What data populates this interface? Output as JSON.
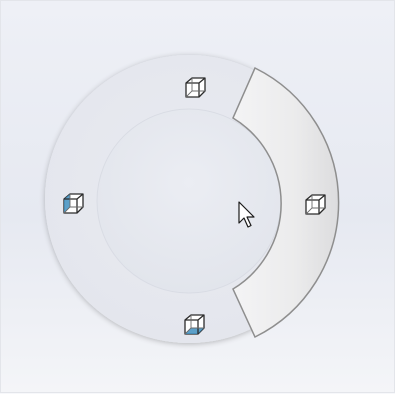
{
  "mouse_gesture_menu": {
    "center_cursor_icon": "cursor-arrow-icon",
    "slots": [
      {
        "position": "top",
        "icon": "view-cube-icon",
        "highlighted": false
      },
      {
        "position": "right",
        "icon": "view-cube-icon",
        "highlighted": true
      },
      {
        "position": "bottom",
        "icon": "view-cube-icon",
        "highlighted": false
      },
      {
        "position": "left",
        "icon": "view-cube-icon",
        "highlighted": false
      }
    ]
  },
  "colors": {
    "background": "#e9ebf2",
    "ring": "#e6e8ee",
    "highlight": "#ececee",
    "highlight_border": "#8e8e8e",
    "cube_face": "#3f8fc0",
    "cube_edge": "#2b2b2b"
  }
}
